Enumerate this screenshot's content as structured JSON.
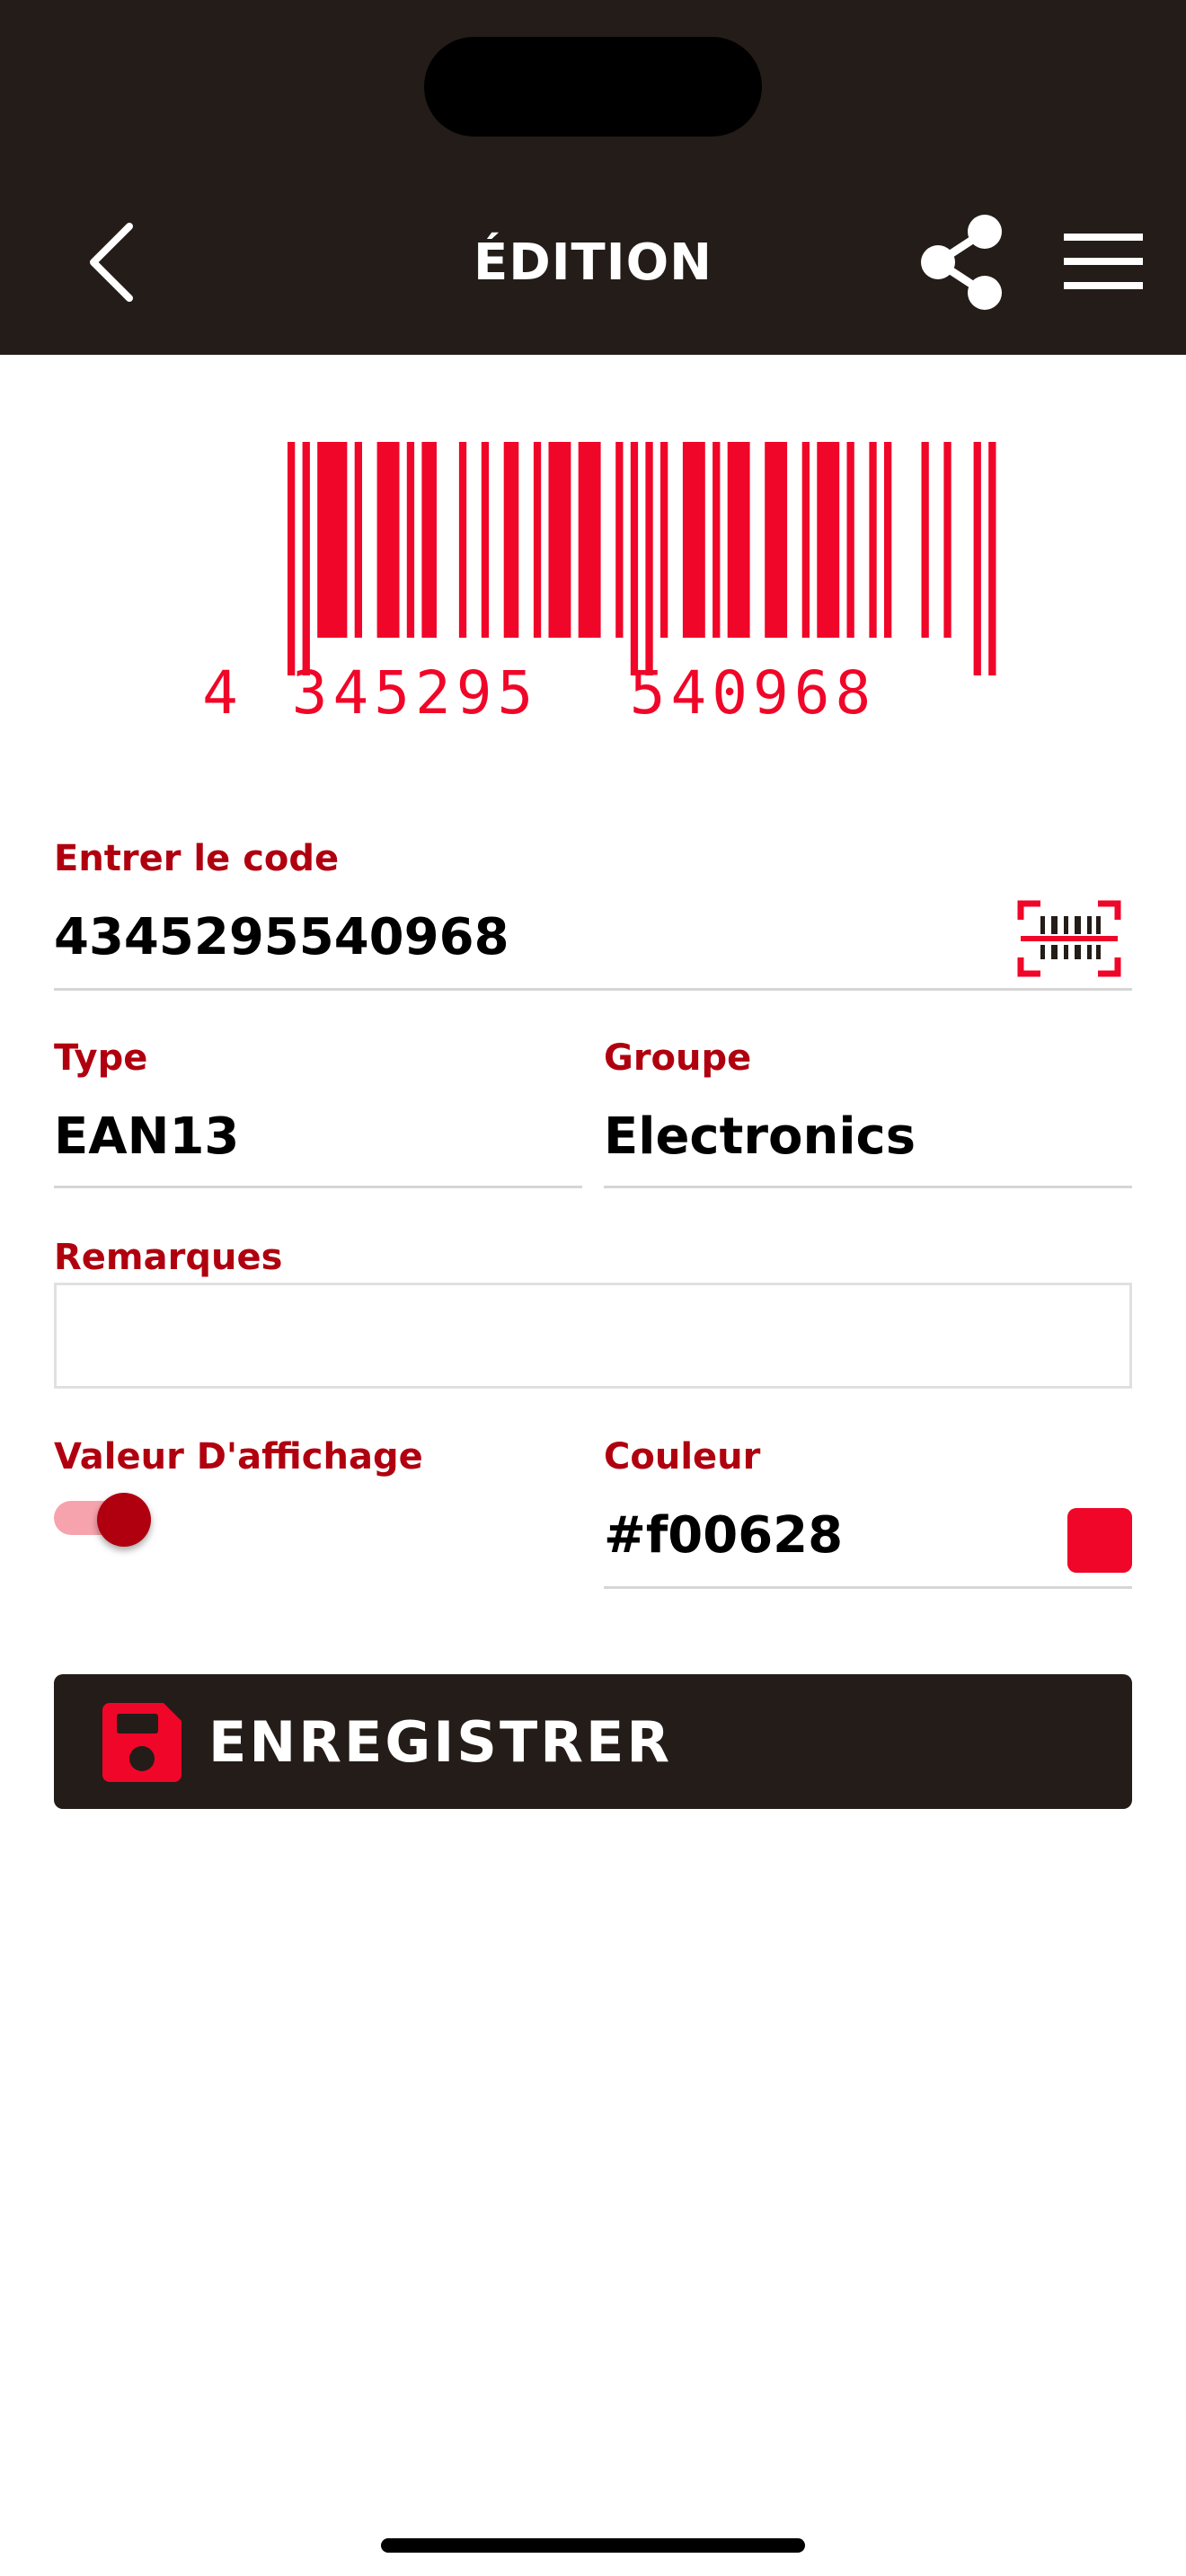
{
  "header": {
    "title": "ÉDITION",
    "back_icon": "chevron-left-icon",
    "share_icon": "share-icon",
    "menu_icon": "hamburger-menu-icon"
  },
  "barcode": {
    "left_digit": "4",
    "left_group": "345295",
    "right_group": "540968",
    "color": "#f00628"
  },
  "code_field": {
    "label": "Entrer le code",
    "value": "4345295540968",
    "scan_icon": "barcode-scan-icon"
  },
  "type_field": {
    "label": "Type",
    "value": "EAN13"
  },
  "group_field": {
    "label": "Groupe",
    "value": "Electronics"
  },
  "remarks_field": {
    "label": "Remarques",
    "value": ""
  },
  "display_value": {
    "label": "Valeur D'affichage",
    "enabled": true
  },
  "color_field": {
    "label": "Couleur",
    "value": "#f00628",
    "swatch": "#f00628"
  },
  "save_button": {
    "label": "ENREGISTRER",
    "icon": "floppy-disk-icon"
  },
  "colors": {
    "header_bg": "#241c18",
    "accent": "#b0000f",
    "barcode": "#f00628"
  }
}
